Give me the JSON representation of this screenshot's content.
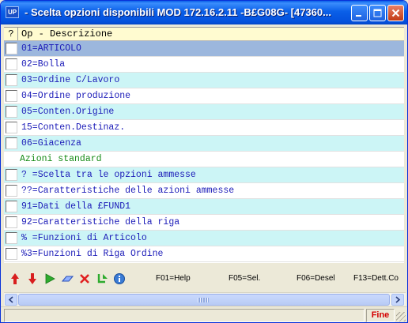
{
  "window": {
    "icon_text": "UP",
    "title": " -  Scelta opzioni disponibili MOD 172.16.2.11 -B£G08G- [47360..."
  },
  "header": {
    "q_label": "?",
    "column_label": "Op - Descrizione"
  },
  "rows": [
    {
      "label": "01=ARTICOLO",
      "style": "selected",
      "has_checkbox": true
    },
    {
      "label": "02=Bolla",
      "style": "white",
      "has_checkbox": true
    },
    {
      "label": "03=Ordine C/Lavoro",
      "style": "cyan",
      "has_checkbox": true
    },
    {
      "label": "04=Ordine produzione",
      "style": "white",
      "has_checkbox": true
    },
    {
      "label": "05=Conten.Origine",
      "style": "cyan",
      "has_checkbox": true
    },
    {
      "label": "15=Conten.Destinaz.",
      "style": "white",
      "has_checkbox": true
    },
    {
      "label": "06=Giacenza",
      "style": "cyan",
      "has_checkbox": true
    },
    {
      "label": "Azioni standard",
      "style": "section",
      "has_checkbox": false
    },
    {
      "label": "? =Scelta tra le opzioni ammesse",
      "style": "cyan",
      "has_checkbox": true
    },
    {
      "label": "??=Caratteristiche delle azioni ammesse",
      "style": "white",
      "has_checkbox": true
    },
    {
      "label": "91=Dati della £FUND1",
      "style": "cyan",
      "has_checkbox": true
    },
    {
      "label": "92=Caratteristiche della riga",
      "style": "white",
      "has_checkbox": true
    },
    {
      "label": "% =Funzioni di Articolo",
      "style": "cyan",
      "has_checkbox": true
    },
    {
      "label": "%3=Funzioni di Riga Ordine",
      "style": "white",
      "has_checkbox": true
    }
  ],
  "toolbar": {
    "icons": [
      "arrow-up-icon",
      "arrow-down-icon",
      "play-icon",
      "eraser-icon",
      "delete-icon",
      "refresh-icon",
      "info-icon"
    ],
    "fkeys": {
      "help": "F01=Help",
      "sel": "F05=Sel.",
      "desel": "F06=Desel",
      "detail": "F13=Dett.Co"
    }
  },
  "status": {
    "text": "",
    "fine": "Fine"
  },
  "colors": {
    "row_cyan": "#ccf5f6",
    "row_selected": "#9cb7dd",
    "text_blue": "#1b1bb8",
    "section_green": "#148a14",
    "fine_red": "#d40000"
  }
}
